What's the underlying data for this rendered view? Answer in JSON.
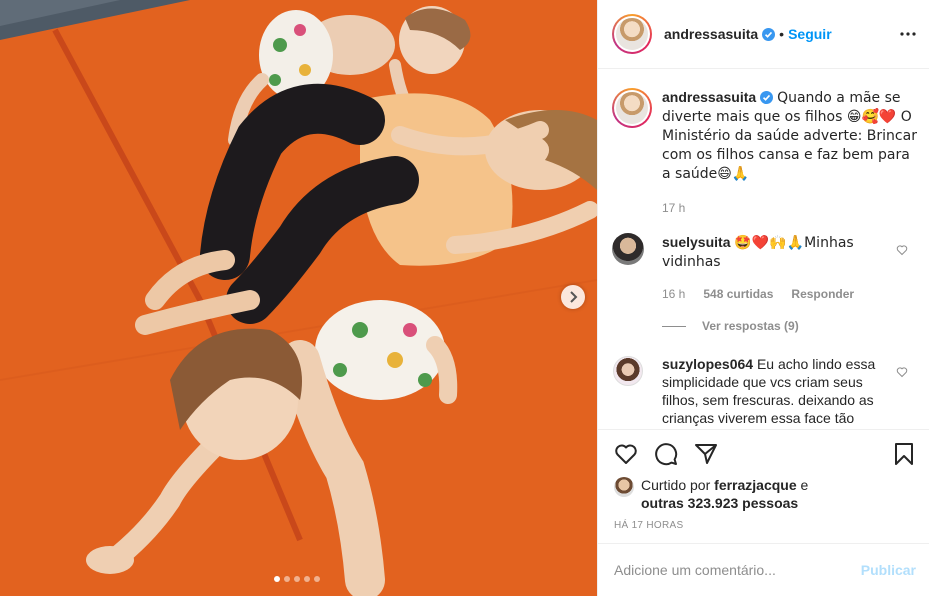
{
  "header": {
    "username": "andressasuita",
    "separator": "•",
    "follow_label": "Seguir"
  },
  "caption": {
    "username": "andressasuita",
    "text": "Quando a mãe se diverte mais que os filhos 😁🥰❤️ O Ministério da saúde adverte: Brincar com os filhos cansa e faz bem para a saúde😄🙏",
    "time": "17 h"
  },
  "comments": [
    {
      "username": "suelysuita",
      "text": "🤩❤️🙌🙏Minhas vidinhas",
      "time": "16 h",
      "likes": "548 curtidas",
      "reply_label": "Responder"
    },
    {
      "username": "suzylopes064",
      "text": "Eu acho lindo essa simplicidade que vcs criam seus filhos, sem frescuras. deixando as crianças viverem essa face tão"
    }
  ],
  "replies_label": "Ver respostas (9)",
  "likes": {
    "prefix": "Curtido por",
    "user": "ferrazjacque",
    "connector": "e",
    "others": "outras 323.923 pessoas"
  },
  "time_ago": "HÁ 17 HORAS",
  "add_comment": {
    "placeholder": "Adicione um comentário...",
    "publish_label": "Publicar"
  },
  "carousel": {
    "slide_count": 5,
    "active_index": 0
  },
  "colors": {
    "accent": "#0095f6",
    "mat": "#e0601f",
    "publish_disabled": "#b2dffc"
  },
  "icons": [
    "verified-icon",
    "more-options-icon",
    "heart-icon",
    "comment-icon",
    "share-icon",
    "bookmark-icon",
    "chevron-right-icon"
  ]
}
